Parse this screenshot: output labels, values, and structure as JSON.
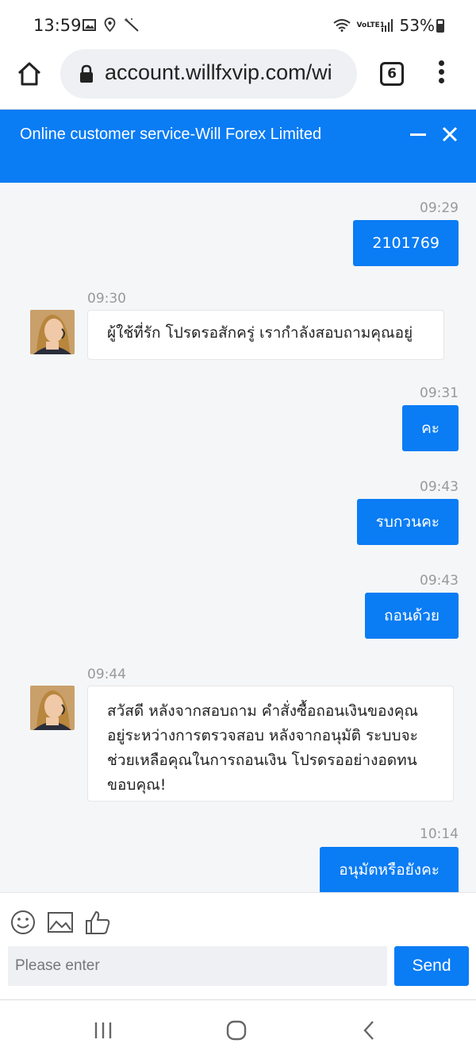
{
  "status_bar": {
    "time": "13:59",
    "network": "VoLTE1",
    "battery_text": "53%",
    "icons_left": [
      "gallery-icon",
      "location-icon",
      "magic-wand-icon"
    ],
    "icons_right": [
      "wifi-icon",
      "volte-icon",
      "signal-icon",
      "battery-icon"
    ]
  },
  "browser": {
    "url": "account.willfxvip.com/wi",
    "tab_count": "6"
  },
  "chat": {
    "title": "Online customer service-Will Forex Limited",
    "accent_color": "#0a7cf4",
    "messages": [
      {
        "side": "out",
        "time": "09:29",
        "text": "2101769"
      },
      {
        "side": "in",
        "time": "09:30",
        "text": "ผู้ใช้ที่รัก โปรดรอสักครู่ เรากำลังสอบถามคุณอยู่"
      },
      {
        "side": "out",
        "time": "09:31",
        "text": "คะ"
      },
      {
        "side": "out",
        "time": "09:43",
        "text": "รบกวนคะ"
      },
      {
        "side": "out",
        "time": "09:43",
        "text": "ถอนด้วย"
      },
      {
        "side": "in",
        "time": "09:44",
        "text": "สวัสดี หลังจากสอบถาม คำสั่งซื้อถอนเงินของคุณอยู่ระหว่างการตรวจสอบ หลังจากอนุมัติ ระบบจะช่วยเหลือคุณในการถอนเงิน โปรดรออย่างอดทน ขอบคุณ!"
      },
      {
        "side": "out",
        "time": "10:14",
        "text": "อนุมัตหรือยังคะ"
      }
    ]
  },
  "composer": {
    "placeholder": "Please enter",
    "send_label": "Send",
    "tools": [
      "emoji-icon",
      "image-icon",
      "thumbs-up-icon"
    ]
  }
}
